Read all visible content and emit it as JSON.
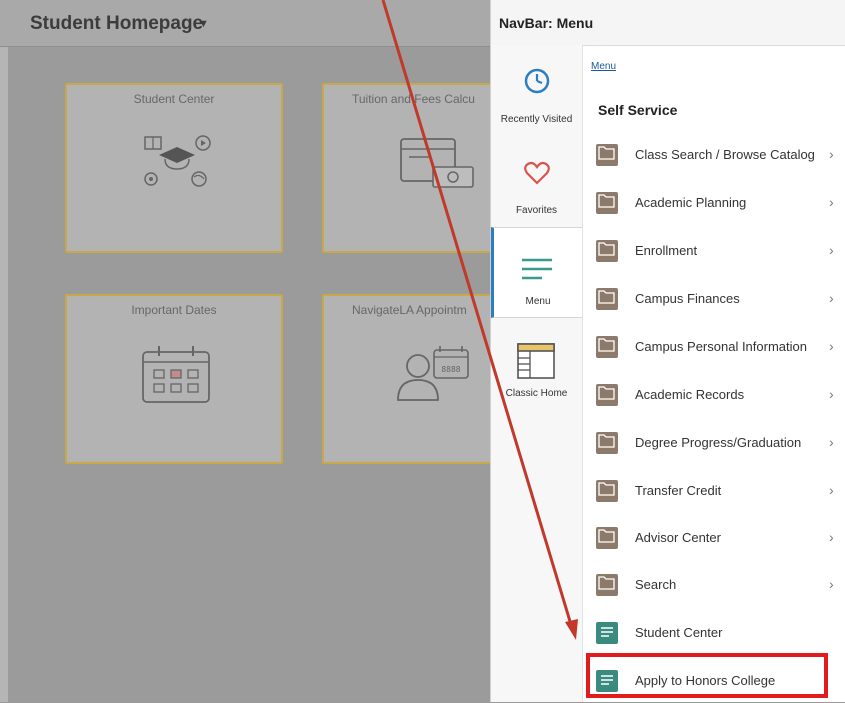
{
  "page": {
    "title": "Student Homepage",
    "tiles": [
      {
        "title": "Student Center",
        "icon": "student-center-icon"
      },
      {
        "title": "Tuition and Fees Calcu",
        "icon": "tuition-calculator-icon"
      },
      {
        "title": "Important Dates",
        "icon": "calendar-icon"
      },
      {
        "title": "NavigateLA Appointm",
        "icon": "appointment-icon"
      }
    ]
  },
  "navbar": {
    "title": "NavBar: Menu",
    "tabs": [
      {
        "label": "Recently Visited",
        "icon": "clock-icon"
      },
      {
        "label": "Favorites",
        "icon": "heart-icon"
      },
      {
        "label": "Menu",
        "icon": "menu-lines-icon"
      },
      {
        "label": "Classic Home",
        "icon": "classic-home-icon"
      }
    ],
    "breadcrumb": "Menu",
    "section_title": "Self Service",
    "items": [
      {
        "label": "Class Search / Browse Catalog",
        "type": "folder"
      },
      {
        "label": "Academic Planning",
        "type": "folder"
      },
      {
        "label": "Enrollment",
        "type": "folder"
      },
      {
        "label": "Campus Finances",
        "type": "folder"
      },
      {
        "label": "Campus Personal Information",
        "type": "folder"
      },
      {
        "label": "Academic Records",
        "type": "folder"
      },
      {
        "label": "Degree Progress/Graduation",
        "type": "folder"
      },
      {
        "label": "Transfer Credit",
        "type": "folder"
      },
      {
        "label": "Advisor Center",
        "type": "folder"
      },
      {
        "label": "Search",
        "type": "folder"
      },
      {
        "label": "Student Center",
        "type": "page"
      },
      {
        "label": "Apply to Honors College",
        "type": "page"
      }
    ],
    "chevron": "›"
  },
  "colors": {
    "folder_icon": "#8c7b6b",
    "page_icon": "#3a8a80",
    "active_tab_accent": "#2b7ec2",
    "annotation_red": "#e21c1c",
    "tile_border": "#c8a848"
  }
}
